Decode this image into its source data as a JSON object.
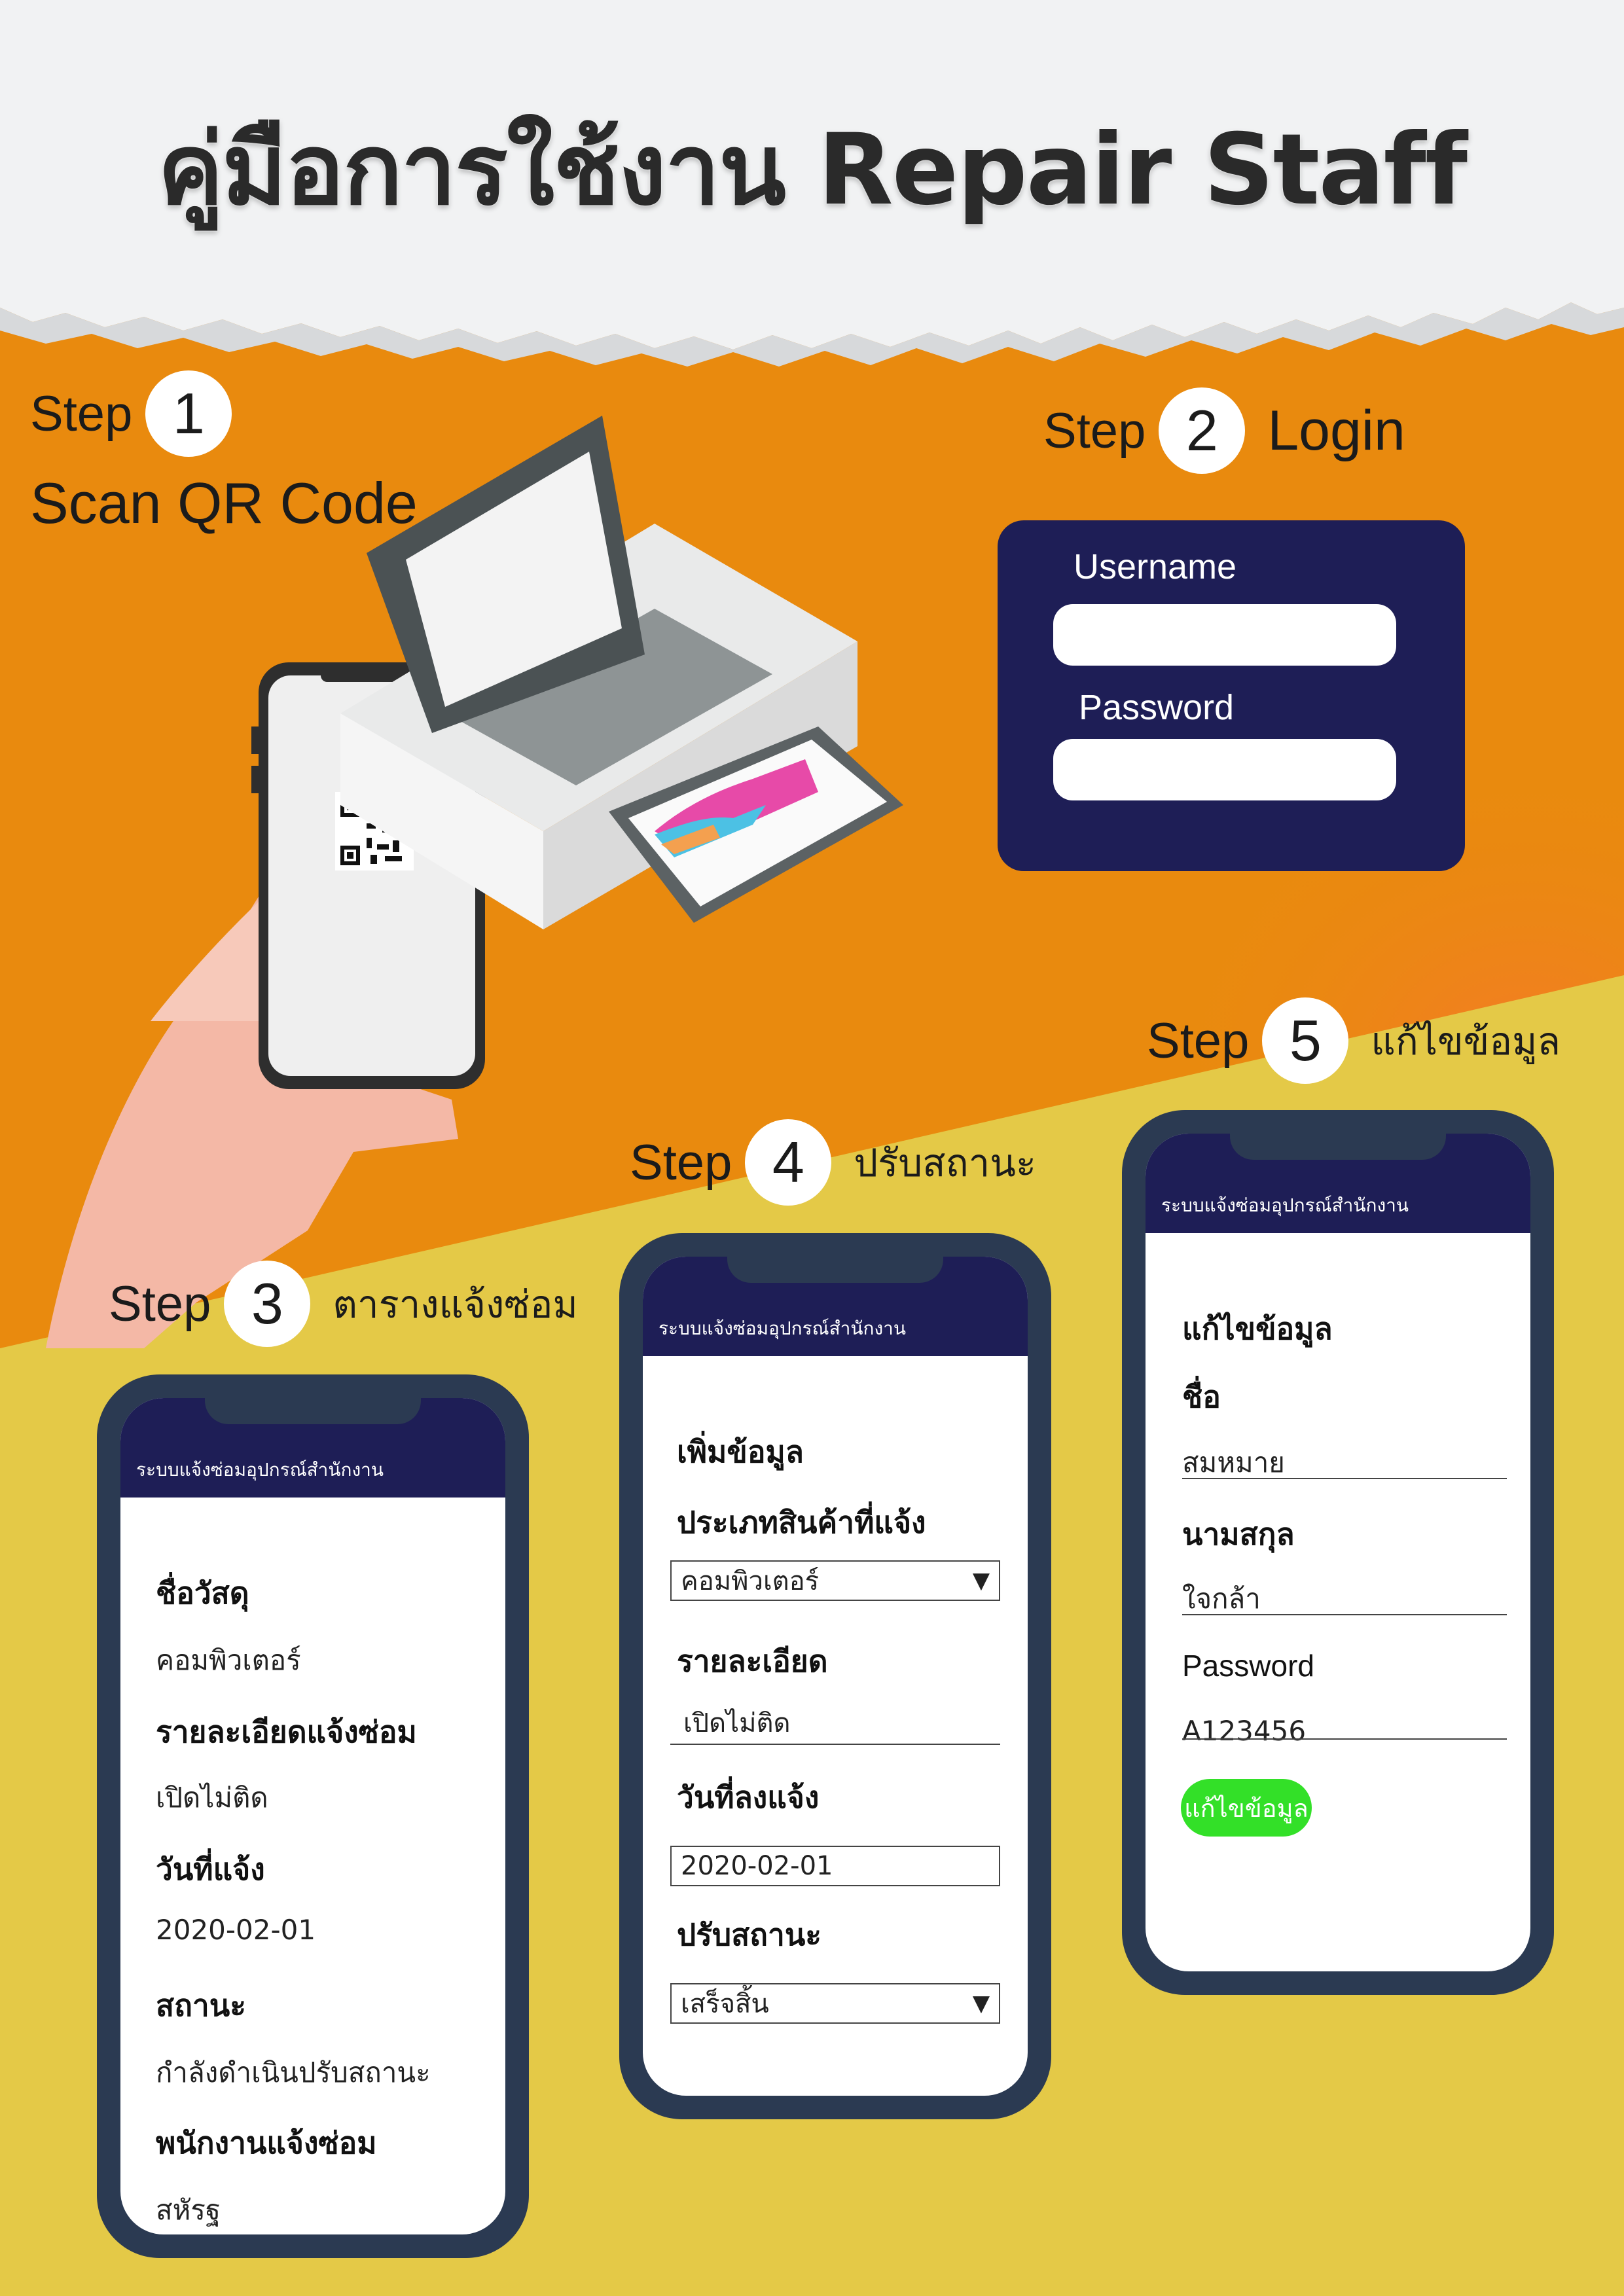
{
  "title": "คู่มือการใช้งาน Repair Staff",
  "colors": {
    "orange": "#E98A0E",
    "yellow": "#E4C947",
    "navy": "#1E1E56",
    "phone_frame": "#2B3A52",
    "button_green": "#33E028"
  },
  "steps": [
    {
      "label": "Step",
      "number": "1",
      "caption": "Scan QR Code"
    },
    {
      "label": "Step",
      "number": "2",
      "caption": "Login"
    },
    {
      "label": "Step",
      "number": "3",
      "caption": "ตารางแจ้งซ่อม"
    },
    {
      "label": "Step",
      "number": "4",
      "caption": "ปรับสถานะ"
    },
    {
      "label": "Step",
      "number": "5",
      "caption": "แก้ไขข้อมูล"
    }
  ],
  "login": {
    "username_label": "Username",
    "password_label": "Password"
  },
  "app_header": "ระบบแจ้งซ่อมอุปกรณ์สำนักงาน",
  "phone3": {
    "fields": [
      {
        "label": "ชื่อวัสดุ",
        "value": "คอมพิวเตอร์"
      },
      {
        "label": "รายละเอียดแจ้งซ่อม",
        "value": "เปิดไม่ติด"
      },
      {
        "label": "วันที่แจ้ง",
        "value": "2020-02-01"
      },
      {
        "label": "สถานะ",
        "value": "กำลังดำเนินปรับสถานะ"
      },
      {
        "label": "พนักงานแจ้งซ่อม",
        "value": "สหัรฐ"
      }
    ]
  },
  "phone4": {
    "heading": "เพิ่มข้อมูล",
    "type_label": "ประเภทสินค้าที่แจ้ง",
    "type_value": "คอมพิวเตอร์",
    "detail_label": "รายละเอียด",
    "detail_value": "เปิดไม่ติด",
    "date_label": "วันที่ลงแจ้ง",
    "date_value": "2020-02-01",
    "status_label": "ปรับสถานะ",
    "status_value": "เสร็จสิ้น",
    "dropdown_icon": "▼"
  },
  "phone5": {
    "heading": "แก้ไขข้อมูล",
    "name_label": "ชื่อ",
    "name_value": "สมหมาย",
    "surname_label": "นามสกุล",
    "surname_value": "ใจกล้า",
    "password_label": "Password",
    "password_value": "A123456",
    "button_label": "แก้ไขข้อมูล"
  }
}
